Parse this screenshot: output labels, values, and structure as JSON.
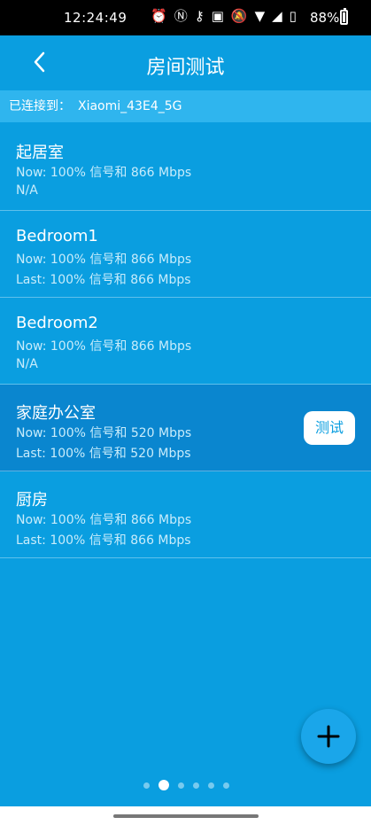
{
  "status": {
    "time": "12:24:49",
    "icons": [
      "alarm-icon",
      "nfc-icon",
      "key-icon",
      "volte-icon",
      "mute-icon",
      "wifi-icon",
      "signal-icon",
      "no-sim-icon"
    ],
    "battery": "88%"
  },
  "appbar": {
    "title": "房间测试"
  },
  "connection": {
    "label": "已连接到：",
    "ssid": "Xiaomi_43E4_5G"
  },
  "rooms": [
    {
      "name": "起居室",
      "now": "Now: 100% 信号和 866 Mbps",
      "last": "N/A"
    },
    {
      "name": "Bedroom1",
      "now": "Now: 100% 信号和 866 Mbps",
      "last": "Last: 100% 信号和 866 Mbps"
    },
    {
      "name": "Bedroom2",
      "now": "Now: 100% 信号和 866 Mbps",
      "last": "N/A"
    },
    {
      "name": "家庭办公室",
      "now": "Now: 100% 信号和 520 Mbps",
      "last": "Last: 100% 信号和 520 Mbps",
      "selected": true,
      "action": "测试"
    },
    {
      "name": "厨房",
      "now": "Now: 100% 信号和 866 Mbps",
      "last": "Last: 100% 信号和 866 Mbps"
    }
  ],
  "pager": {
    "count": 6,
    "active": 1
  },
  "colors": {
    "background": "#0a9ee0",
    "selected": "#0a86cf",
    "connbar": "#2fb5ee",
    "button_text": "#0a9ee0"
  }
}
